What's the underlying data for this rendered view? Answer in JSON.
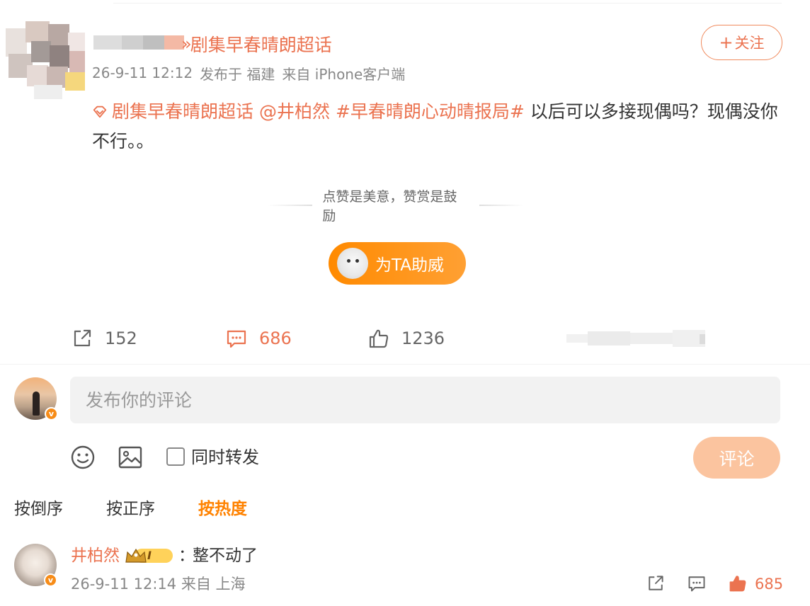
{
  "post": {
    "supertopic_name": "剧集早春晴朗超话",
    "follow_label": "关注",
    "follow_plus": "+",
    "meta": {
      "time": "26-9-11 12:12",
      "location": "发布于 福建",
      "source": "来自 iPhone客户端"
    },
    "text_parts": {
      "topic": "剧集早春晴朗超话",
      "mention": "@井柏然",
      "hashtag": "#早春晴朗心动晴报局#",
      "body": " 以后可以多接现偶吗？现偶没你不行。。"
    },
    "encourage_text": "点赞是美意，赞赏是鼓励",
    "cheer_label": "为TA助威",
    "actions": {
      "repost_count": "152",
      "comment_count": "686",
      "like_count": "1236"
    }
  },
  "composer": {
    "placeholder": "发布你的评论",
    "repost_label": "同时转发",
    "submit_label": "评论"
  },
  "sort": {
    "desc": "按倒序",
    "asc": "按正序",
    "hot": "按热度"
  },
  "comments": [
    {
      "name": "井柏然",
      "badge_text": "I",
      "colon": "：",
      "text": "整不动了",
      "meta": "26-9-11 12:14 来自 上海",
      "like_count": "685"
    }
  ],
  "colors": {
    "accent": "#eb7350",
    "orange": "#ff8200",
    "submit_disabled": "#fbc49f",
    "verified": "#f78c18"
  },
  "icons": {
    "supertopic": "supertopic-diamond-icon",
    "repost": "share-arrow-icon",
    "comment": "comment-bubble-icon",
    "like": "thumbs-up-icon",
    "emoji": "smiley-icon",
    "image": "image-icon",
    "verified": "verified-v-icon",
    "crown": "crown-level-badge-icon"
  }
}
